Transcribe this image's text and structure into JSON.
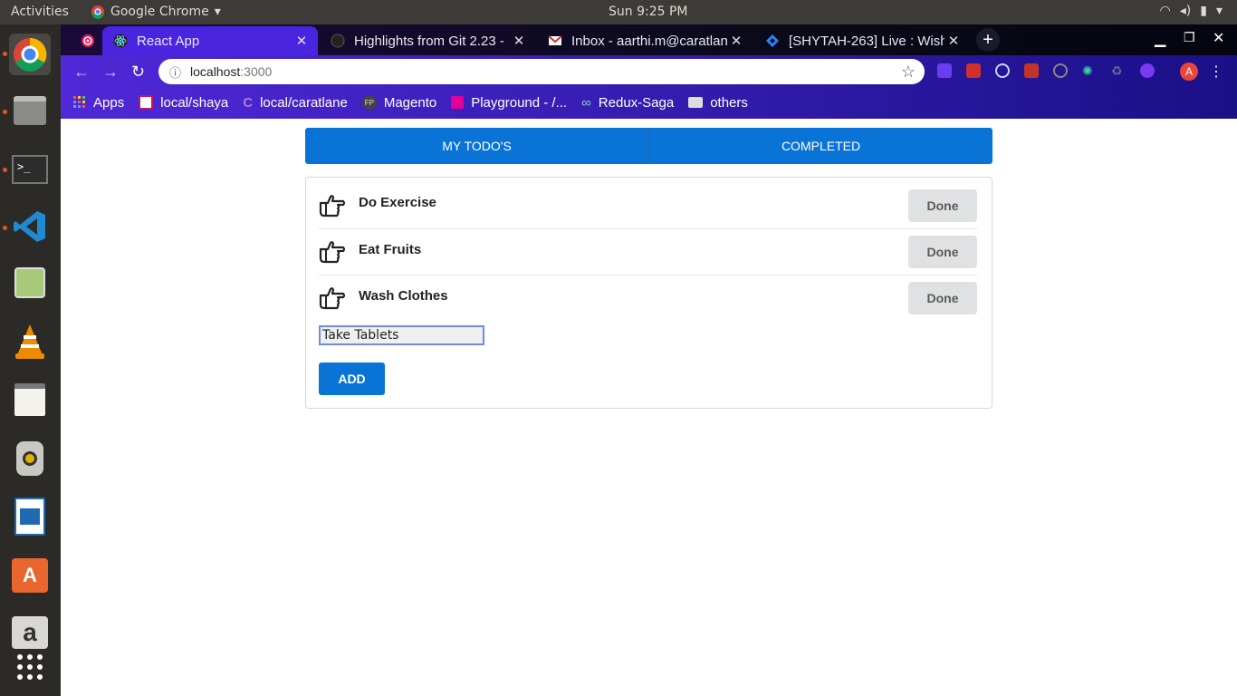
{
  "topbar": {
    "activities": "Activities",
    "app_name": "Google Chrome",
    "clock": "Sun  9:25 PM"
  },
  "browser": {
    "tabs": [
      {
        "title": "React App"
      },
      {
        "title": "Highlights from Git 2.23 -"
      },
      {
        "title": "Inbox - aarthi.m@caratlan"
      },
      {
        "title": "[SHYTAH-263] Live : Wishl"
      }
    ],
    "url_host": "localhost",
    "url_port": ":3000",
    "bookmarks": [
      "Apps",
      "local/shaya",
      "local/caratlane",
      "Magento",
      "Playground - /...",
      "Redux-Saga",
      "others"
    ],
    "profile_initial": "A"
  },
  "app": {
    "tabs": [
      "MY TODO'S",
      "COMPLETED"
    ],
    "todos": [
      {
        "text": "Do Exercise",
        "button": "Done"
      },
      {
        "text": "Eat Fruits",
        "button": "Done"
      },
      {
        "text": "Wash Clothes",
        "button": "Done"
      }
    ],
    "input_value": "Take Tablets",
    "add_label": "ADD"
  },
  "colors": {
    "primary": "#0a74d6",
    "done_button": "#e0e1e2",
    "chrome_accent": "#4a25e0"
  }
}
